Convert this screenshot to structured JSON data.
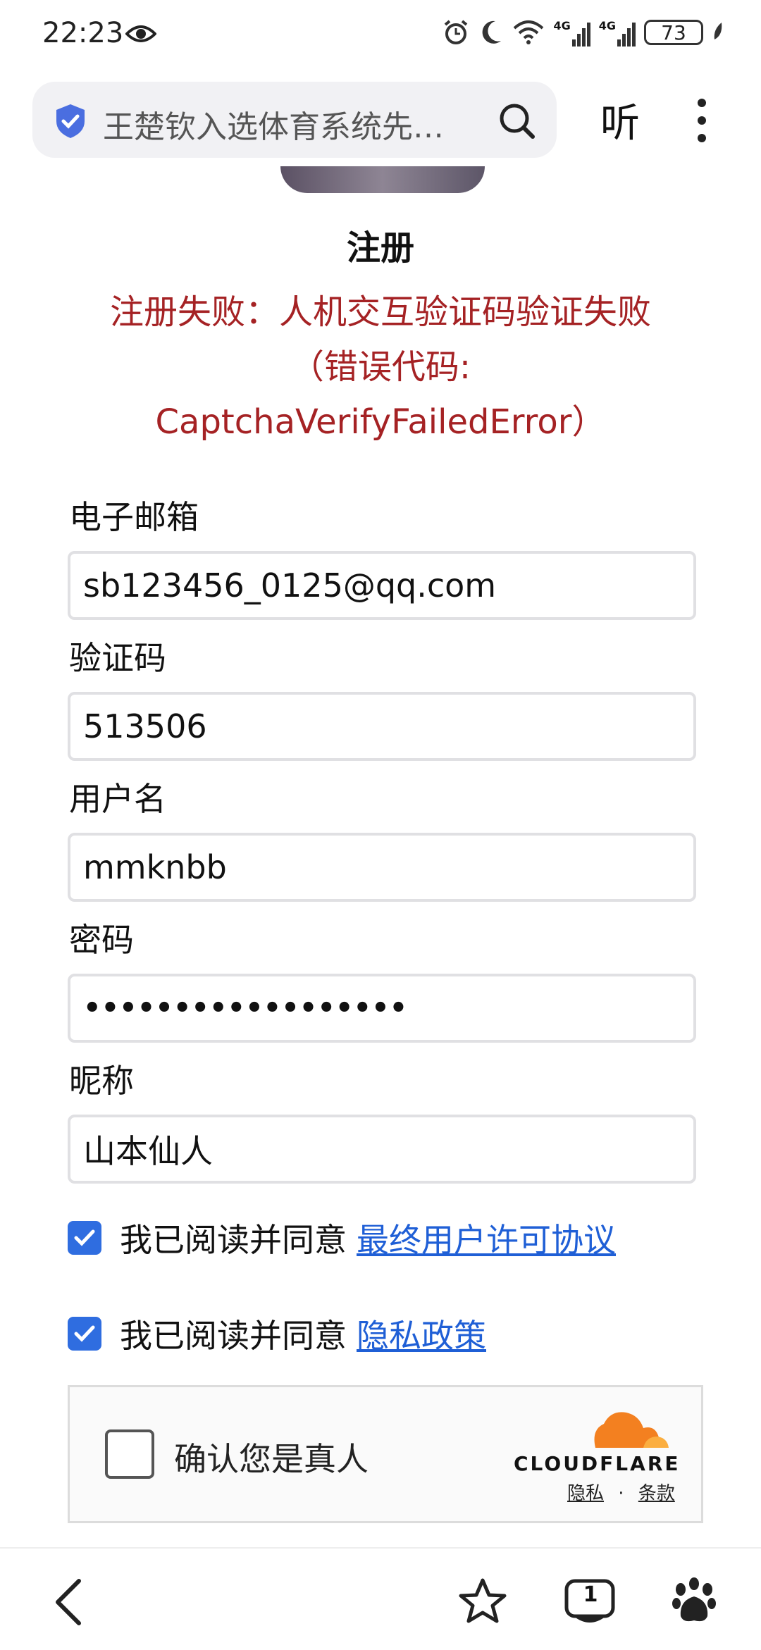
{
  "status_bar": {
    "time": "22:23",
    "battery": "73",
    "signal1": "4G",
    "signal2": "4G"
  },
  "address_bar": {
    "text": "王楚钦入选体育系统先…",
    "listen_label": "听"
  },
  "page": {
    "title": "注册",
    "error_line1": "注册失败：人机交互验证码验证失败",
    "error_line2": "（错误代码:",
    "error_line3": "CaptchaVerifyFailedError）",
    "fields": [
      {
        "label": "电子邮箱",
        "value": "sb123456_0125@qq.com"
      },
      {
        "label": "验证码",
        "value": "513506"
      },
      {
        "label": "用户名",
        "value": "mmknbb"
      },
      {
        "label": "密码",
        "value": "••••••••••••••••••"
      },
      {
        "label": "昵称",
        "value": "山本仙人"
      }
    ],
    "agree_prefix": "我已阅读并同意",
    "eula_link": "最终用户许可协议",
    "privacy_link": "隐私政策"
  },
  "captcha": {
    "label": "确认您是真人",
    "brand": "CLOUDFLARE",
    "privacy": "隐私",
    "separator": "·",
    "terms": "条款"
  },
  "bottom_nav": {
    "tab_count": "1"
  },
  "colors": {
    "error": "#a52224",
    "link": "#1f5fd6",
    "checkbox": "#2f6de0",
    "cloudflare_orange": "#f38020"
  }
}
